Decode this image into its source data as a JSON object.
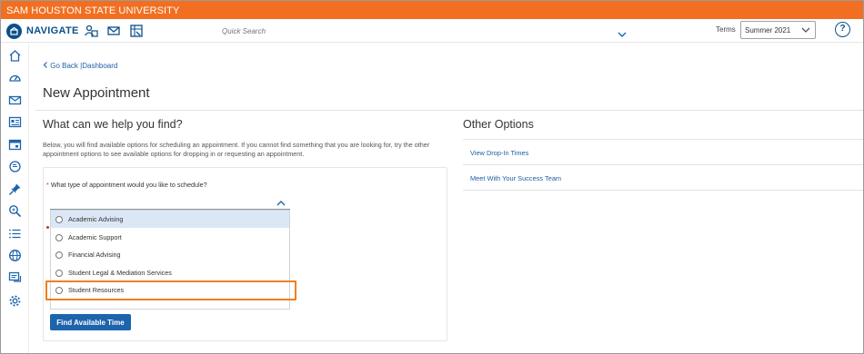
{
  "topbar": {
    "title": "SAM HOUSTON STATE UNIVERSITY"
  },
  "brand": {
    "name": "NAVIGATE"
  },
  "search": {
    "placeholder": "Quick Search"
  },
  "terms": {
    "label": "Terms",
    "selected": "Summer 2021"
  },
  "help": {
    "label": "?"
  },
  "back_link": "Go Back |Dashboard",
  "page_title": "New Appointment",
  "left": {
    "title": "What can we help you find?",
    "description": "Below, you will find available options for scheduling an appointment. If you cannot find something that you are looking for, try the other appointment options to see available options for dropping in or requesting an appointment.",
    "question_required": "*",
    "question": "What type of appointment would you like to schedule?",
    "options": [
      {
        "label": "Academic Advising"
      },
      {
        "label": "Academic Support"
      },
      {
        "label": "Financial Advising"
      },
      {
        "label": "Student Legal & Mediation Services"
      },
      {
        "label": "Student Resources"
      }
    ],
    "find_button": "Find Available Time"
  },
  "right": {
    "title": "Other Options",
    "links": [
      {
        "label": "View Drop-In Times"
      },
      {
        "label": "Meet With Your Success Team"
      }
    ]
  },
  "colors": {
    "topbar": "#f26f21",
    "brand": "#0b4f8a",
    "link": "#1f5fa5",
    "button": "#1d64ad",
    "highlight": "#f07f1f",
    "selected_row": "#dbe7f5"
  },
  "icons": {
    "nav": [
      "students-icon",
      "mail-icon",
      "calendar-icon"
    ],
    "sidebar": [
      "home-icon",
      "dashboard-icon",
      "message-icon",
      "card-icon",
      "calendar-icon",
      "reports-icon",
      "pin-icon",
      "search-icon",
      "list-icon",
      "globe-icon",
      "chat-icon",
      "settings-icon"
    ]
  }
}
